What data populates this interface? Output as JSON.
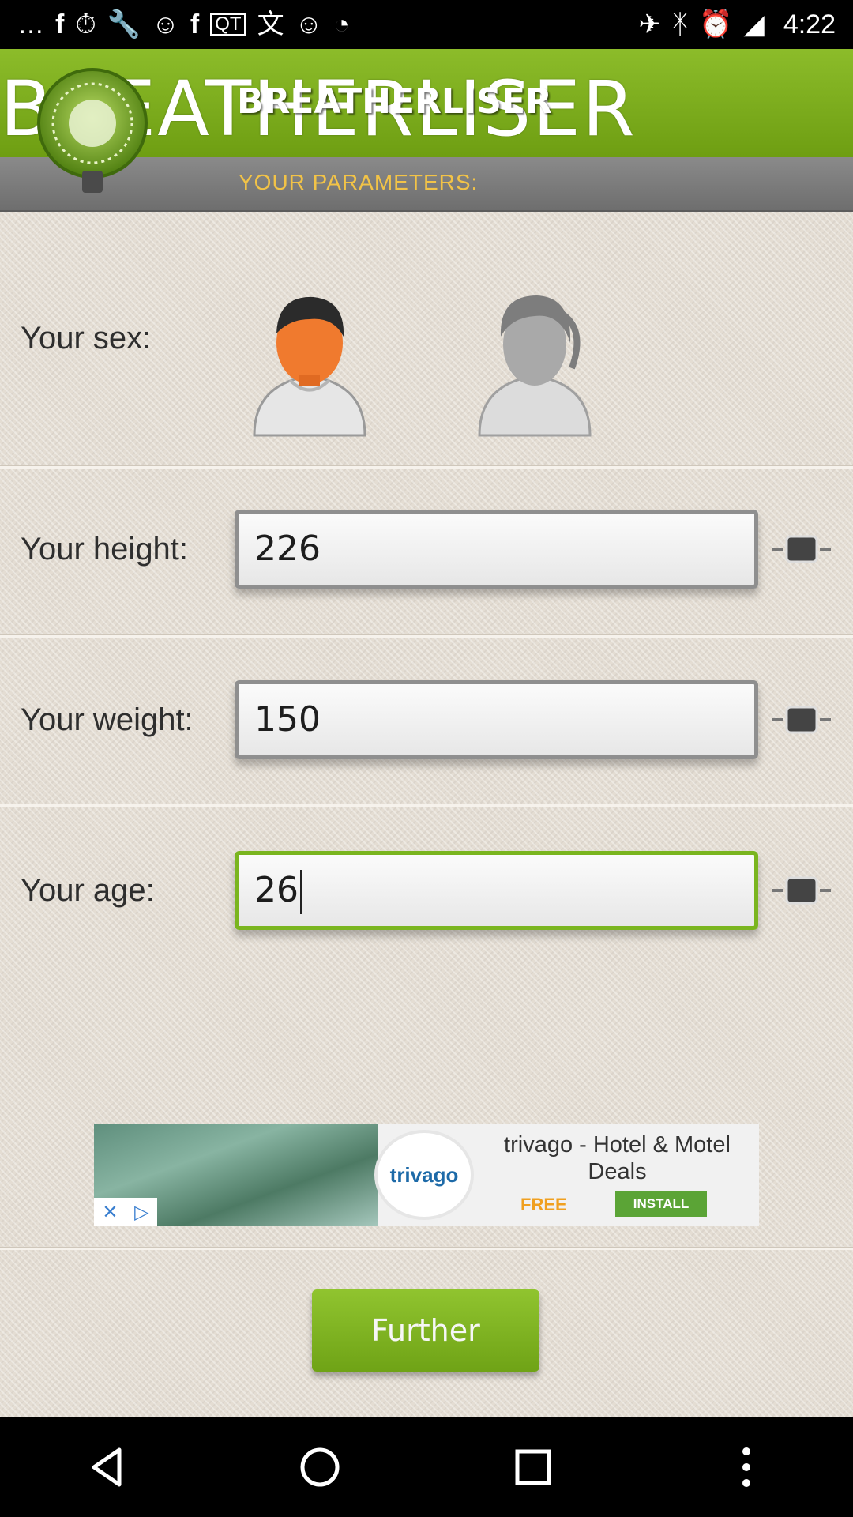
{
  "status_bar": {
    "time": "4:22",
    "icons": [
      "more-icon",
      "facebook-icon",
      "timer-icon",
      "wrench-icon",
      "smiley-icon",
      "facebook-icon",
      "qt-icon",
      "translate-icon",
      "smiley-icon",
      "stopwatch-icon",
      "gps-fake-icon",
      "bluetooth-icon",
      "alarm-icon",
      "signal-icon"
    ]
  },
  "header": {
    "big_title": "BREATHERLISER",
    "title": "BREATHERLISER",
    "params_label": "YOUR PARAMETERS:"
  },
  "form": {
    "sex_label": "Your sex:",
    "height_label": "Your height:",
    "height_value": "226",
    "weight_label": "Your weight:",
    "weight_value": "150",
    "age_label": "Your age:",
    "age_value": "26"
  },
  "ad": {
    "logo_text": "trivago",
    "title": "trivago - Hotel & Motel Deals",
    "free": "FREE",
    "install": "INSTALL"
  },
  "further_button": "Further",
  "colors": {
    "accent": "#7ab51f",
    "params_text": "#f2c347",
    "header_bg": "#6e9e12"
  }
}
